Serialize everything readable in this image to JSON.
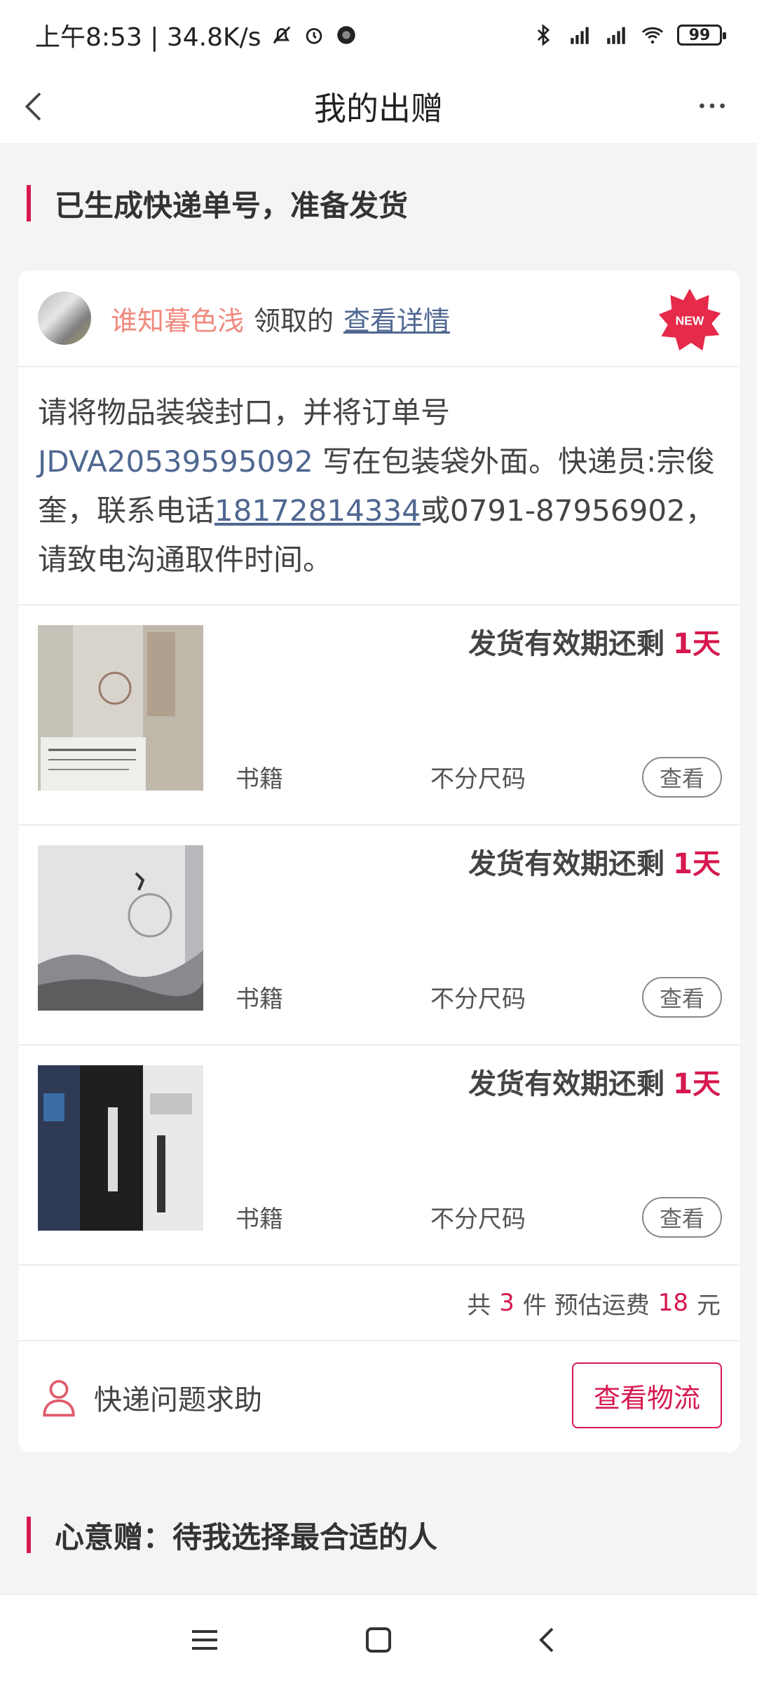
{
  "status_bar": {
    "time_speed": "上午8:53 | 34.8K/s",
    "battery": "99",
    "icons": [
      "bell-off-icon",
      "alarm-icon",
      "app-dot-icon",
      "bluetooth-icon",
      "signal-hd-icon",
      "signal-hd-icon",
      "wifi-icon",
      "battery-icon"
    ]
  },
  "header": {
    "title": "我的出赠",
    "back_icon": "chevron-left-icon",
    "more_icon": "more-horizontal-icon"
  },
  "section1": {
    "title": "已生成快递单号，准备发货"
  },
  "card": {
    "receiver": "谁知暮色浅",
    "receive_text": "领取的",
    "detail_link": "查看详情",
    "new_badge": "NEW",
    "notice": {
      "part1": "请将物品装袋封口，并将订单号",
      "order_no": "JDVA20539595092",
      "part2": "写在包装袋外面。快递员:宗俊奎，联系电话",
      "phone": "18172814334",
      "part3": "或0791-87956902，请致电沟通取件时间。"
    },
    "items": [
      {
        "deadline_label": "发货有效期还剩",
        "deadline_value": "1天",
        "category": "书籍",
        "size": "不分尺码",
        "view": "查看"
      },
      {
        "deadline_label": "发货有效期还剩",
        "deadline_value": "1天",
        "category": "书籍",
        "size": "不分尺码",
        "view": "查看"
      },
      {
        "deadline_label": "发货有效期还剩",
        "deadline_value": "1天",
        "category": "书籍",
        "size": "不分尺码",
        "view": "查看"
      }
    ],
    "summary": {
      "prefix": "共",
      "count": "3",
      "mid": "件 预估运费",
      "fee": "18",
      "unit": "元"
    },
    "help_text": "快递问题求助",
    "logistics_button": "查看物流"
  },
  "section2": {
    "title": "心意赠：待我选择最合适的人"
  },
  "colors": {
    "accent": "#d6184e",
    "link": "#4f6791",
    "receiver": "#f08a7e",
    "background": "#f4f4f4"
  }
}
